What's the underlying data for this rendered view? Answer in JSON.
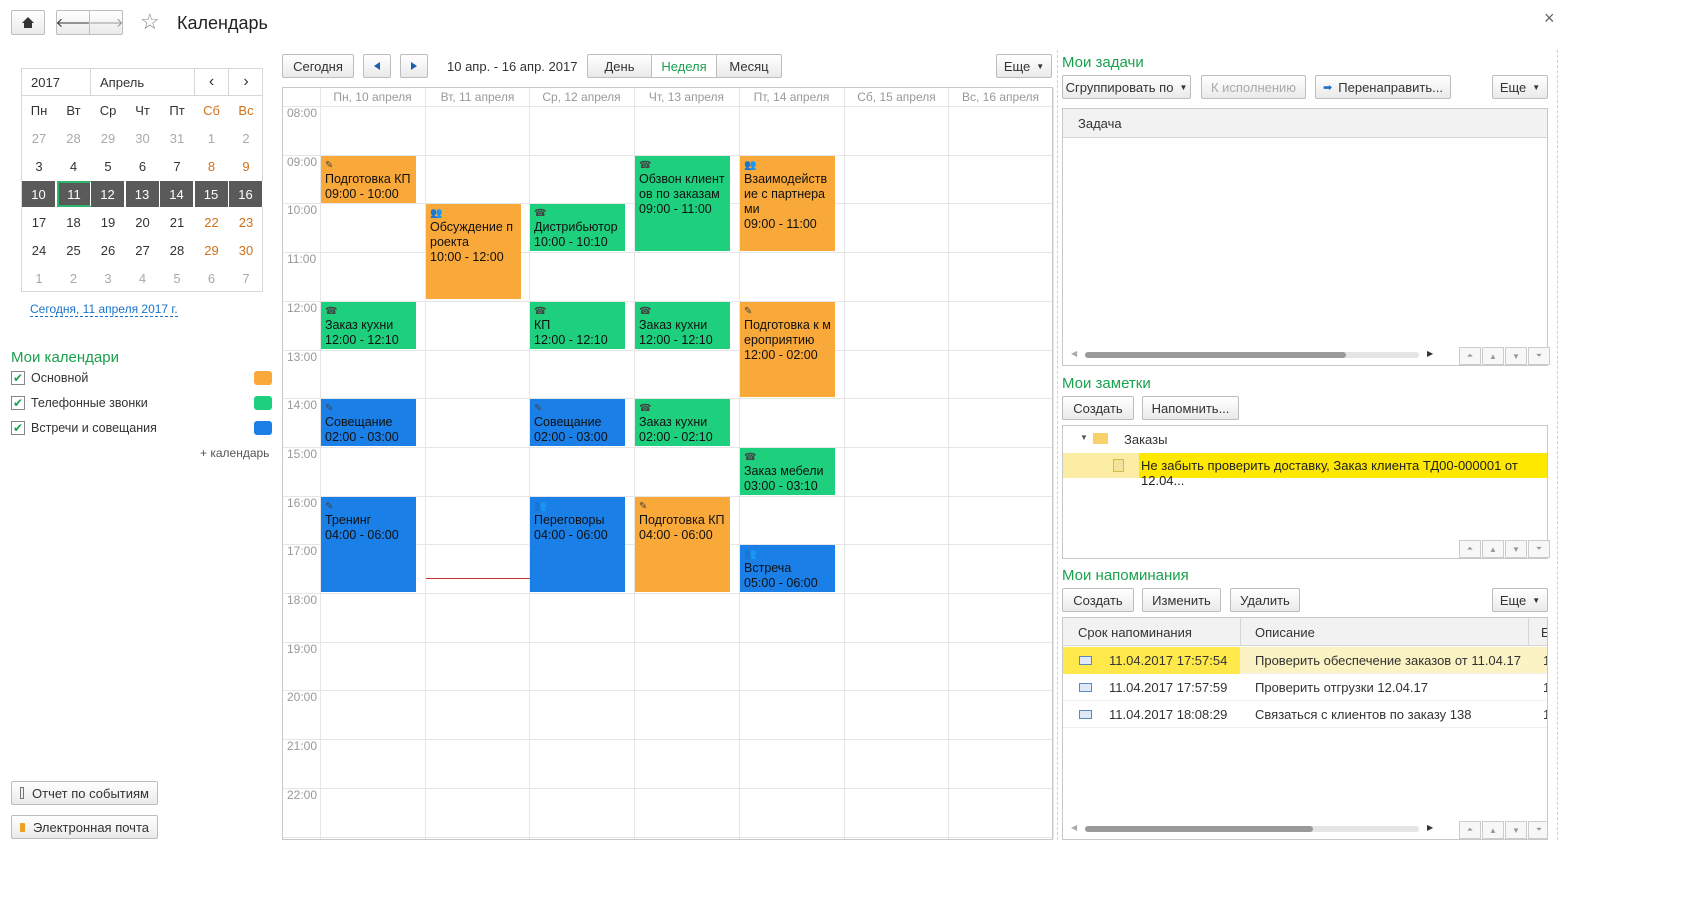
{
  "window": {
    "title": "Календарь",
    "close_glyph": "×"
  },
  "toolbar": {
    "home_icon": "home-icon",
    "back_glyph": "🡐",
    "forward_glyph": "🡒",
    "star_glyph": "☆"
  },
  "mini_calendar": {
    "year": "2017",
    "month": "Апрель",
    "prev_glyph": "‹",
    "next_glyph": "›",
    "weekdays": [
      "Пн",
      "Вт",
      "Ср",
      "Чт",
      "Пт",
      "Сб",
      "Вс"
    ],
    "weeks": [
      [
        "27",
        "28",
        "29",
        "30",
        "31",
        "1",
        "2"
      ],
      [
        "3",
        "4",
        "5",
        "6",
        "7",
        "8",
        "9"
      ],
      [
        "10",
        "11",
        "12",
        "13",
        "14",
        "15",
        "16"
      ],
      [
        "17",
        "18",
        "19",
        "20",
        "21",
        "22",
        "23"
      ],
      [
        "24",
        "25",
        "26",
        "27",
        "28",
        "29",
        "30"
      ],
      [
        "1",
        "2",
        "3",
        "4",
        "5",
        "6",
        "7"
      ]
    ],
    "today_link": "Сегодня, 11 апреля 2017 г."
  },
  "my_calendars": {
    "title": "Мои календари",
    "items": [
      {
        "label": "Основной",
        "color": "#f9a83a"
      },
      {
        "label": "Телефонные звонки",
        "color": "#1ed07e"
      },
      {
        "label": "Встречи и совещания",
        "color": "#1a7fe6"
      }
    ],
    "add_label": "+ календарь"
  },
  "bottom_buttons": {
    "report": "Отчет по событиям",
    "email": "Электронная почта"
  },
  "nav": {
    "today": "Сегодня",
    "range": "10 апр. - 16 апр. 2017",
    "view_day": "День",
    "view_week": "Неделя",
    "view_month": "Месяц",
    "more": "Еще"
  },
  "week": {
    "days": [
      "Пн, 10 апреля",
      "Вт, 11 апреля",
      "Ср, 12 апреля",
      "Чт, 13 апреля",
      "Пт, 14 апреля",
      "Сб, 15 апреля",
      "Вс, 16 апреля"
    ],
    "hours": [
      "08:00",
      "09:00",
      "10:00",
      "11:00",
      "12:00",
      "13:00",
      "14:00",
      "15:00",
      "16:00",
      "17:00",
      "18:00",
      "19:00",
      "20:00",
      "21:00",
      "22:00"
    ]
  },
  "events": [
    {
      "day": 0,
      "start": 9.0,
      "end": 10.0,
      "lines": [
        "Подготовка КП",
        "09:00 - 10:00"
      ],
      "kind": "note",
      "color": "#f9a83a"
    },
    {
      "day": 0,
      "start": 12.0,
      "end": 13.0,
      "lines": [
        "Заказ кухни",
        "12:00 - 12:10"
      ],
      "kind": "phone",
      "color": "#1ed07e"
    },
    {
      "day": 0,
      "start": 14.0,
      "end": 15.0,
      "lines": [
        "Совещание",
        "02:00 - 03:00"
      ],
      "kind": "note",
      "color": "#1a7fe6"
    },
    {
      "day": 0,
      "start": 16.0,
      "end": 18.0,
      "lines": [
        "Тренинг",
        "04:00 - 06:00"
      ],
      "kind": "note",
      "color": "#1a7fe6"
    },
    {
      "day": 1,
      "start": 10.0,
      "end": 12.0,
      "lines": [
        "Обсуждение п",
        "роекта",
        "10:00 - 12:00"
      ],
      "kind": "meeting",
      "color": "#f9a83a"
    },
    {
      "day": 2,
      "start": 10.0,
      "end": 11.0,
      "lines": [
        "Дистрибьютор",
        "10:00 - 10:10"
      ],
      "kind": "phone",
      "color": "#1ed07e"
    },
    {
      "day": 2,
      "start": 12.0,
      "end": 13.0,
      "lines": [
        "КП",
        "12:00 - 12:10"
      ],
      "kind": "phone",
      "color": "#1ed07e"
    },
    {
      "day": 2,
      "start": 14.0,
      "end": 15.0,
      "lines": [
        "Совещание",
        "02:00 - 03:00"
      ],
      "kind": "note",
      "color": "#1a7fe6"
    },
    {
      "day": 2,
      "start": 16.0,
      "end": 18.0,
      "lines": [
        "Переговоры",
        "04:00 - 06:00"
      ],
      "kind": "meeting",
      "color": "#1a7fe6"
    },
    {
      "day": 3,
      "start": 9.0,
      "end": 11.0,
      "lines": [
        "Обзвон клиент",
        "ов по заказам",
        "09:00 - 11:00"
      ],
      "kind": "phone",
      "color": "#1ed07e"
    },
    {
      "day": 3,
      "start": 12.0,
      "end": 13.0,
      "lines": [
        "Заказ кухни",
        "12:00 - 12:10"
      ],
      "kind": "phone",
      "color": "#1ed07e"
    },
    {
      "day": 3,
      "start": 14.0,
      "end": 15.0,
      "lines": [
        "Заказ кухни",
        "02:00 - 02:10"
      ],
      "kind": "phone",
      "color": "#1ed07e"
    },
    {
      "day": 3,
      "start": 16.0,
      "end": 18.0,
      "lines": [
        "Подготовка КП",
        "04:00 - 06:00"
      ],
      "kind": "note",
      "color": "#f9a83a"
    },
    {
      "day": 4,
      "start": 9.0,
      "end": 11.0,
      "lines": [
        "Взаимодейств",
        "ие с партнера",
        "ми",
        "09:00 - 11:00"
      ],
      "kind": "meeting",
      "color": "#f9a83a"
    },
    {
      "day": 4,
      "start": 12.0,
      "end": 14.0,
      "lines": [
        "Подготовка к м",
        "ероприятию",
        "12:00 - 02:00"
      ],
      "kind": "note",
      "color": "#f9a83a"
    },
    {
      "day": 4,
      "start": 15.0,
      "end": 16.0,
      "lines": [
        "Заказ мебели",
        "03:00 - 03:10"
      ],
      "kind": "phone",
      "color": "#1ed07e"
    },
    {
      "day": 4,
      "start": 17.0,
      "end": 18.0,
      "lines": [
        "Встреча",
        "05:00 - 06:00"
      ],
      "kind": "meeting",
      "color": "#1a7fe6"
    }
  ],
  "current_time": {
    "day": 1,
    "hour": 17.7,
    "color": "#cc3333"
  },
  "tasks": {
    "title": "Мои задачи",
    "group_by": "Сгруппировать по",
    "to_execute": "К исполнению",
    "redirect": "Перенаправить...",
    "more": "Еще",
    "column": "Задача"
  },
  "notes": {
    "title": "Мои заметки",
    "create": "Создать",
    "remind": "Напомнить...",
    "folder": "Заказы",
    "item": "Не забыть проверить доставку, Заказ клиента ТД00-000001 от 12.04..."
  },
  "reminders": {
    "title": "Мои напоминания",
    "create": "Создать",
    "edit": "Изменить",
    "delete": "Удалить",
    "more": "Еще",
    "col_due": "Срок напоминания",
    "col_desc": "Описание",
    "col_extra": "Е",
    "rows": [
      {
        "due": "11.04.2017 17:57:54",
        "desc": "Проверить обеспечение заказов от 11.04.17",
        "extra": "1"
      },
      {
        "due": "11.04.2017 17:57:59",
        "desc": "Проверить отгрузки 12.04.17",
        "extra": "1"
      },
      {
        "due": "11.04.2017 18:08:29",
        "desc": "Связаться с клиентов по заказу 138",
        "extra": "1"
      }
    ]
  },
  "icons": {
    "phone": "☎",
    "note": "✎",
    "meeting": "👥",
    "folder": "folder-icon",
    "note_item": "note-icon",
    "reminder": "reminder-icon"
  }
}
